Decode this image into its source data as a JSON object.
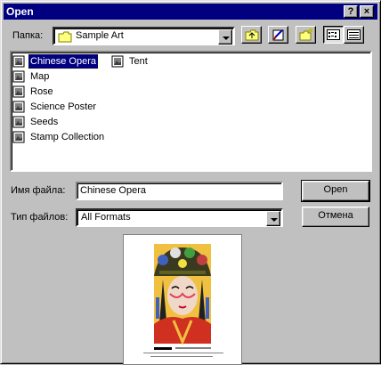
{
  "window": {
    "title": "Open"
  },
  "title_buttons": {
    "help": "?",
    "close": "×"
  },
  "folder": {
    "label": "Папка:",
    "value": "Sample Art"
  },
  "files": [
    {
      "name": "Chinese Opera",
      "selected": true
    },
    {
      "name": "Map"
    },
    {
      "name": "Rose"
    },
    {
      "name": "Science Poster"
    },
    {
      "name": "Seeds"
    },
    {
      "name": "Stamp Collection"
    },
    {
      "name": "Tent"
    }
  ],
  "filename": {
    "label": "Имя файла:",
    "value": "Chinese Opera"
  },
  "filetype": {
    "label": "Тип файлов:",
    "value": "All Formats"
  },
  "buttons": {
    "open": "Open",
    "cancel": "Отмена"
  },
  "icons": {
    "folder": "folder-icon",
    "up": "up-folder-icon",
    "favorites": "look-in-favorites-icon",
    "new_folder": "new-folder-icon",
    "list": "list-view-icon",
    "details": "details-view-icon"
  }
}
